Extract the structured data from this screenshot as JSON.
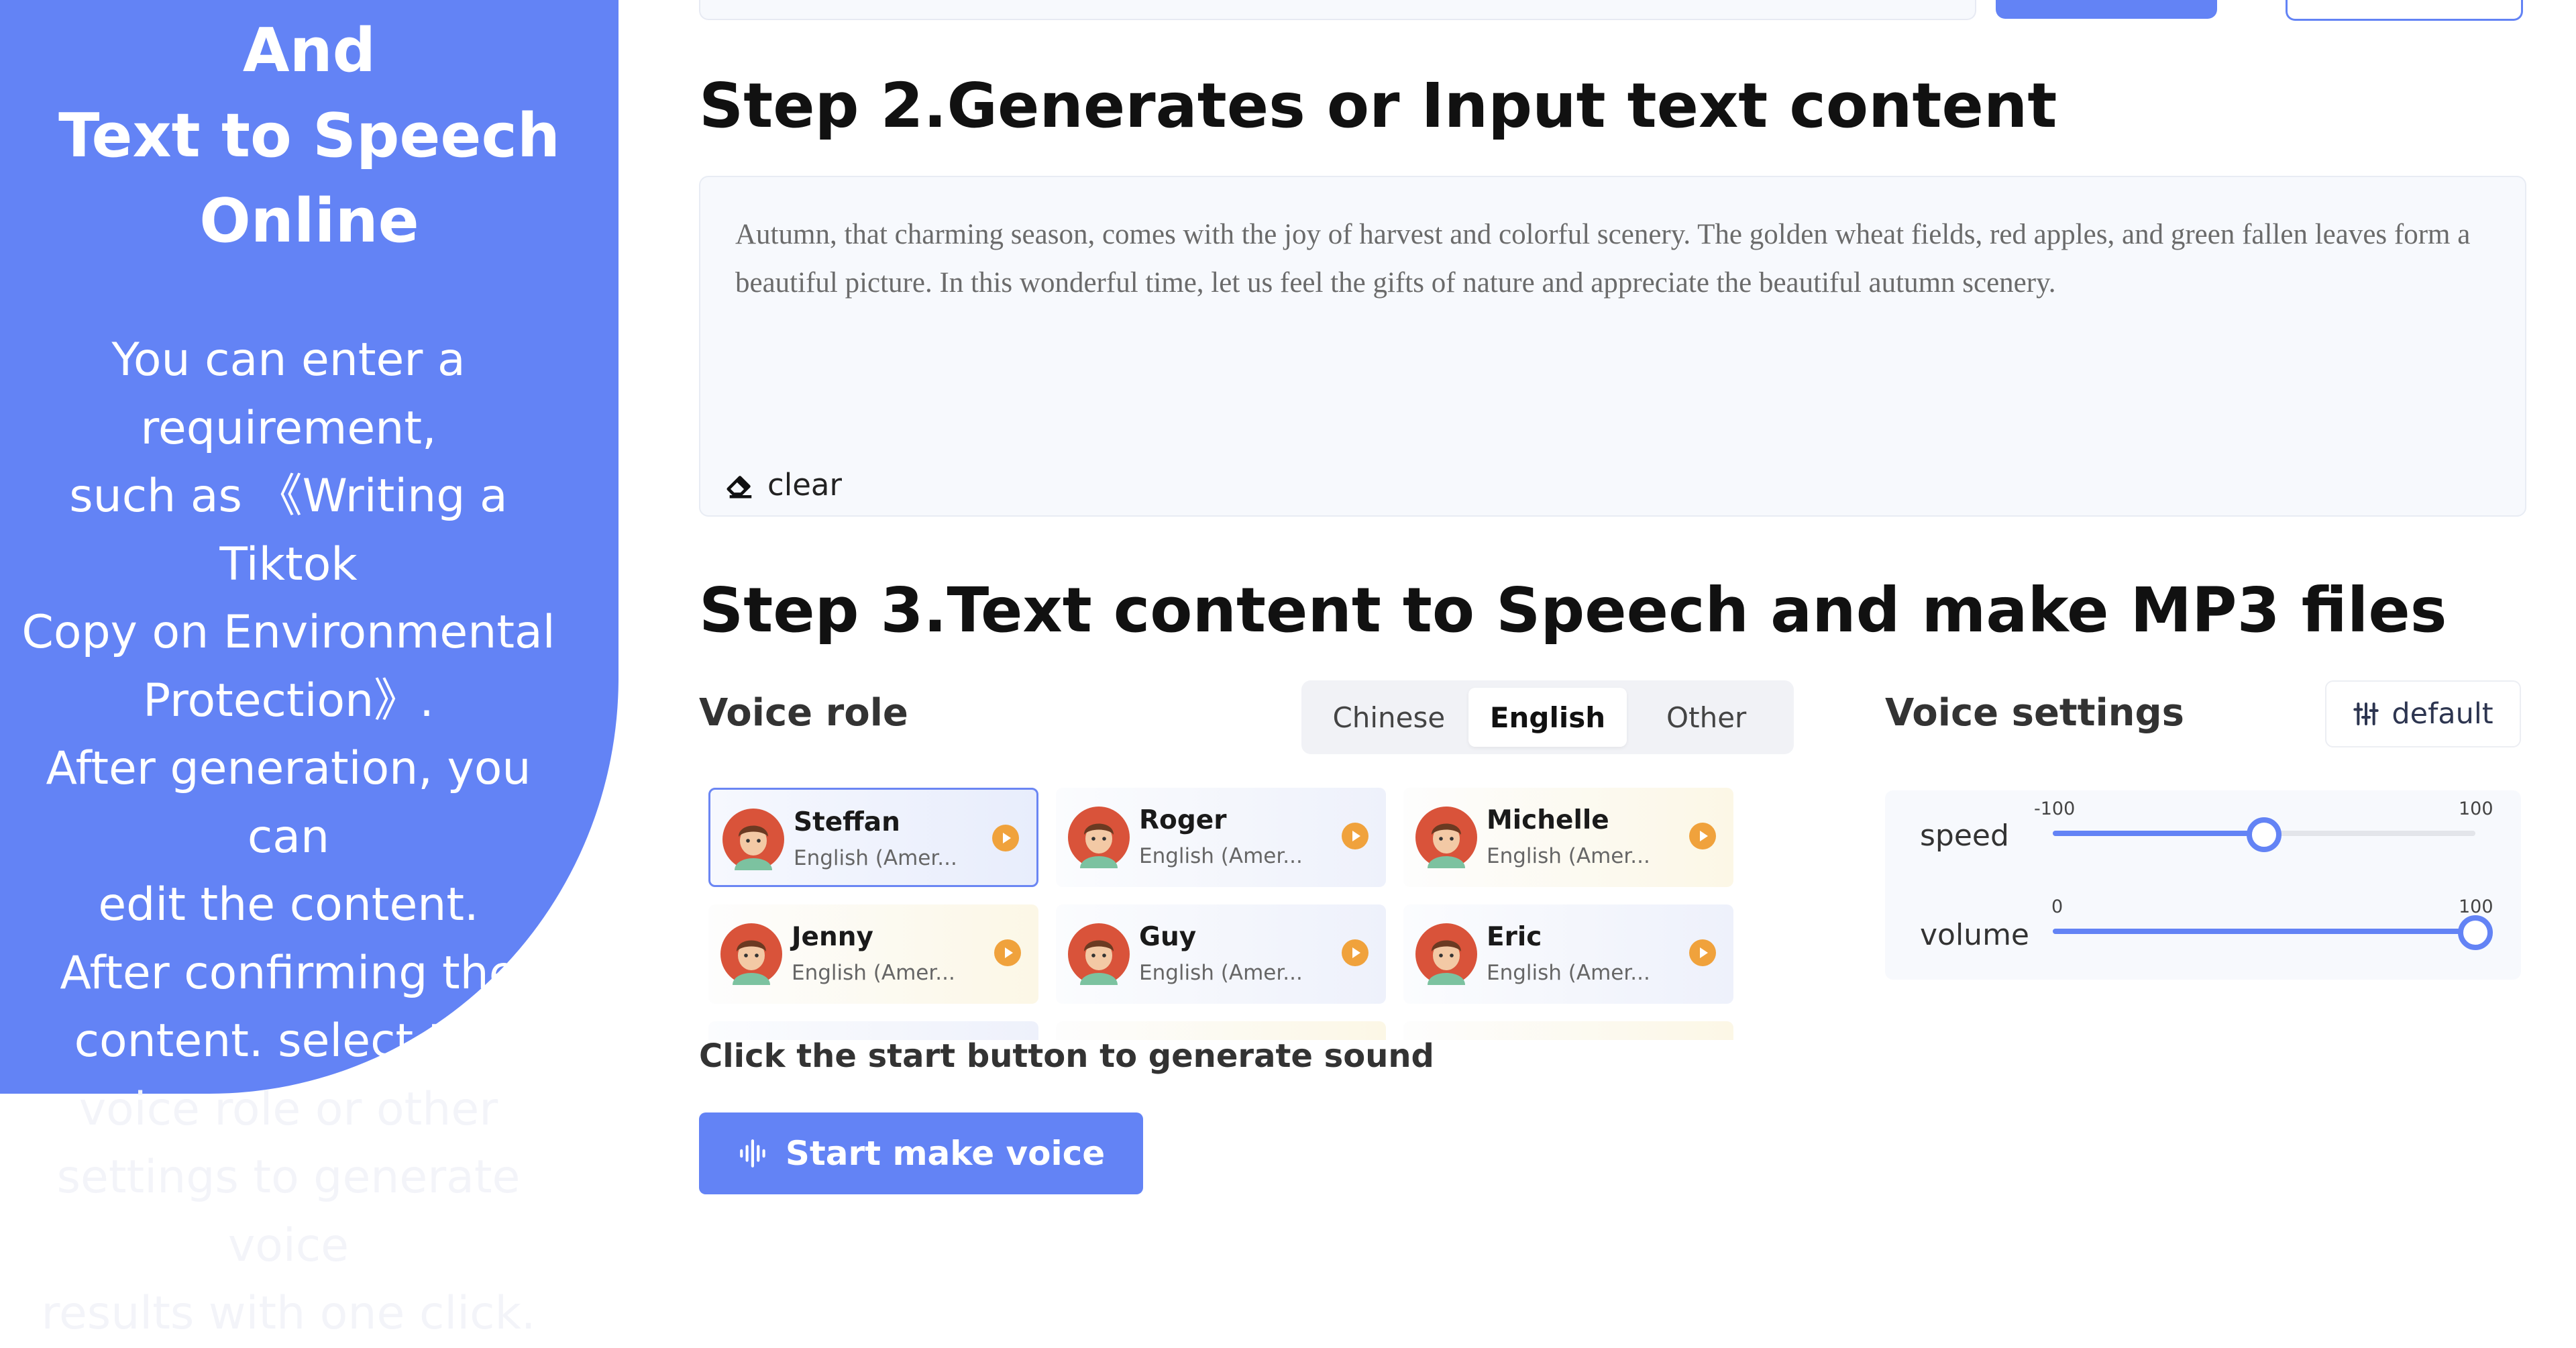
{
  "banner": {
    "title_lines": [
      "And",
      "Text to Speech",
      "Online"
    ],
    "desc_lines": [
      "You can enter a",
      "requirement,",
      "such as 《Writing a",
      "Tiktok",
      "Copy on Environmental",
      "Protection》.",
      "After generation, you",
      "can",
      "edit the content.",
      "After confirming the",
      "content. select the",
      "voice role or other",
      "settings to generate",
      "voice",
      "results with one click."
    ]
  },
  "step2": {
    "title": "Step 2.Generates or Input text content",
    "content": "Autumn, that charming season, comes with the joy of harvest and colorful scenery. The golden wheat fields, red apples, and green fallen leaves form a beautiful picture. In this wonderful time, let us feel the gifts of nature and appreciate the beautiful autumn scenery.",
    "clear_label": "clear"
  },
  "step3": {
    "title": "Step 3.Text content to Speech and make MP3 files",
    "voice_role_label": "Voice role",
    "tabs": [
      {
        "label": "Chinese",
        "active": false
      },
      {
        "label": "English",
        "active": true
      },
      {
        "label": "Other",
        "active": false
      }
    ],
    "voices": [
      {
        "name": "Steffan",
        "sub": "English (Amer...",
        "selected": true,
        "tone": "cool"
      },
      {
        "name": "Roger",
        "sub": "English (Amer...",
        "selected": false,
        "tone": "cool"
      },
      {
        "name": "Michelle",
        "sub": "English (Amer...",
        "selected": false,
        "tone": "warm"
      },
      {
        "name": "Jenny",
        "sub": "English (Amer...",
        "selected": false,
        "tone": "warm"
      },
      {
        "name": "Guy",
        "sub": "English (Amer...",
        "selected": false,
        "tone": "cool"
      },
      {
        "name": "Eric",
        "sub": "English (Amer...",
        "selected": false,
        "tone": "cool"
      }
    ],
    "hint": "Click the start button to generate sound",
    "start_label": "Start make voice"
  },
  "settings": {
    "title": "Voice settings",
    "default_label": "default",
    "speed": {
      "label": "speed",
      "min": "-100",
      "max": "100",
      "value": 0
    },
    "volume": {
      "label": "volume",
      "min": "0",
      "max": "100",
      "value": 100
    }
  },
  "colors": {
    "accent": "#6383f5",
    "play": "#f0a23c",
    "avatar": "#d9533a"
  },
  "icons": {
    "clear": "eraser-icon",
    "start": "sound-wave-icon",
    "default": "sliders-icon",
    "play": "play-icon"
  }
}
